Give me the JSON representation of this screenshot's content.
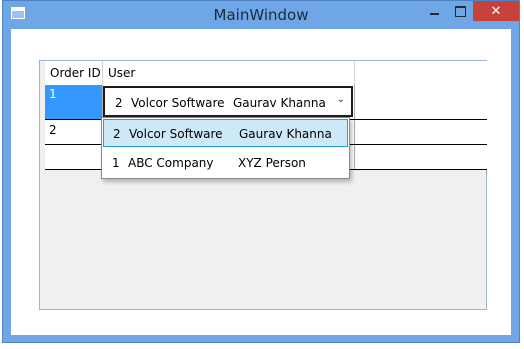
{
  "window": {
    "title": "MainWindow",
    "close_glyph": "✕"
  },
  "grid": {
    "columns": [
      "Order ID",
      "User"
    ],
    "rows": [
      {
        "order_id": "1",
        "user": {
          "id": "2",
          "company": "Volcor Software",
          "person": "Gaurav Khanna"
        }
      },
      {
        "order_id": "2"
      },
      {
        "order_id": ""
      }
    ]
  },
  "combo": {
    "selected": {
      "id": "2",
      "company": "Volcor Software",
      "person": "Gaurav Khanna"
    },
    "arrow": "⌄"
  },
  "dropdown": {
    "items": [
      {
        "id": "2",
        "company": "Volcor Software",
        "person": "Gaurav Khanna",
        "highlighted": true
      },
      {
        "id": "1",
        "company": "ABC Company",
        "person": "XYZ Person",
        "highlighted": false
      }
    ]
  },
  "colors": {
    "titlebar": "#6fa7e6",
    "close_button": "#c7423a",
    "selection": "#3399ff",
    "dropdown_highlight": "#cde8f6",
    "dropdown_highlight_border": "#26a0da"
  }
}
